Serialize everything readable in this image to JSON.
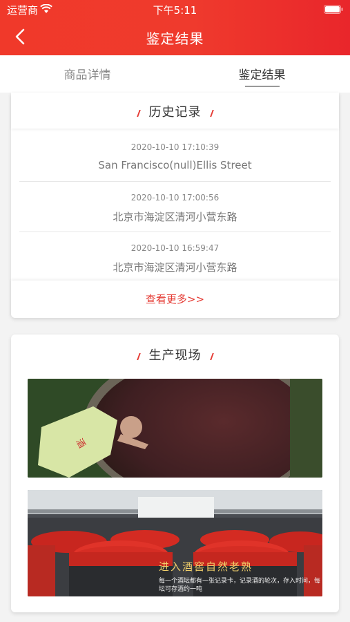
{
  "status_bar": {
    "carrier": "运营商",
    "time": "下午5:11"
  },
  "nav": {
    "title": "鉴定结果"
  },
  "tabs": [
    {
      "label": "商品详情",
      "active": false
    },
    {
      "label": "鉴定结果",
      "active": true
    }
  ],
  "history": {
    "title": "历史记录",
    "items": [
      {
        "time": "2020-10-10 17:10:39",
        "location": "San Francisco(null)Ellis Street"
      },
      {
        "time": "2020-10-10 17:00:56",
        "location": "北京市海淀区清河小营东路"
      },
      {
        "time": "2020-10-10 16:59:47",
        "location": "北京市海淀区清河小营东路"
      }
    ],
    "more_label": "查看更多>>"
  },
  "production": {
    "title": "生产现场",
    "photo2_caption": "进入酒窖自然老熟",
    "photo2_subcaption": "每一个酒坛都有一张记录卡，记录酒的轮次，存入时间，每坛可存酒约一吨"
  },
  "colors": {
    "accent": "#e53a33",
    "header_start": "#f0392a",
    "header_end": "#e9262b"
  }
}
